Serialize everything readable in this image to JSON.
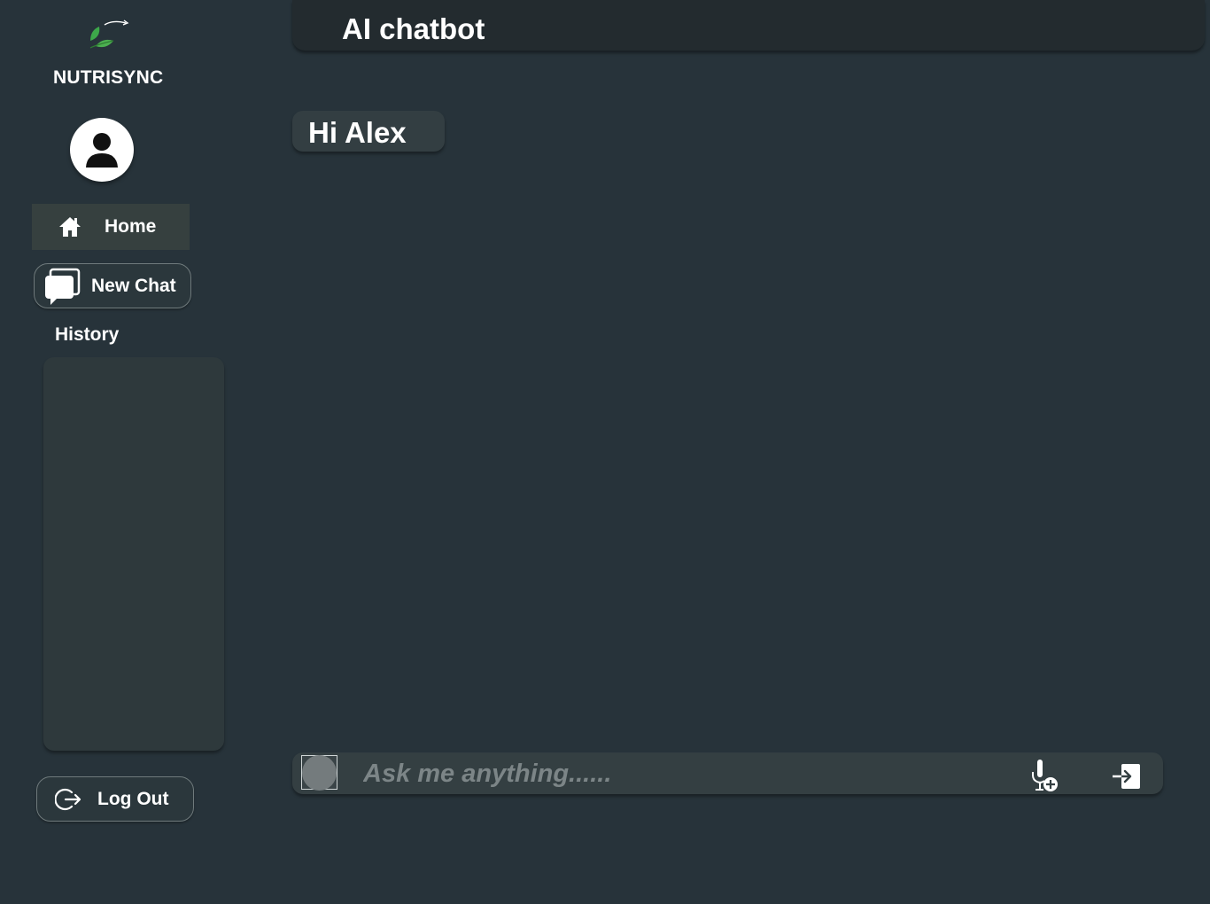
{
  "app": {
    "brand": "NUTRISYNC",
    "title": "AI chatbot"
  },
  "sidebar": {
    "home_label": "Home",
    "new_chat_label": "New Chat",
    "history_title": "History",
    "history_items": [],
    "logout_label": "Log Out"
  },
  "chat": {
    "greeting": "Hi Alex",
    "input_placeholder": "Ask me anything......",
    "input_value": ""
  },
  "icons": {
    "logo": "leaf-logo-icon",
    "avatar": "user-icon",
    "home": "home-icon",
    "new_chat": "chat-bubbles-icon",
    "logout": "logout-icon",
    "attach": "attach-icon",
    "mic": "microphone-add-icon",
    "send": "send-icon"
  },
  "colors": {
    "background": "#27333a",
    "top_bar": "#232b2f",
    "panel": "#2e393c",
    "accent_green": "#3da84a",
    "text": "#ffffff",
    "placeholder": "#7c8587"
  }
}
